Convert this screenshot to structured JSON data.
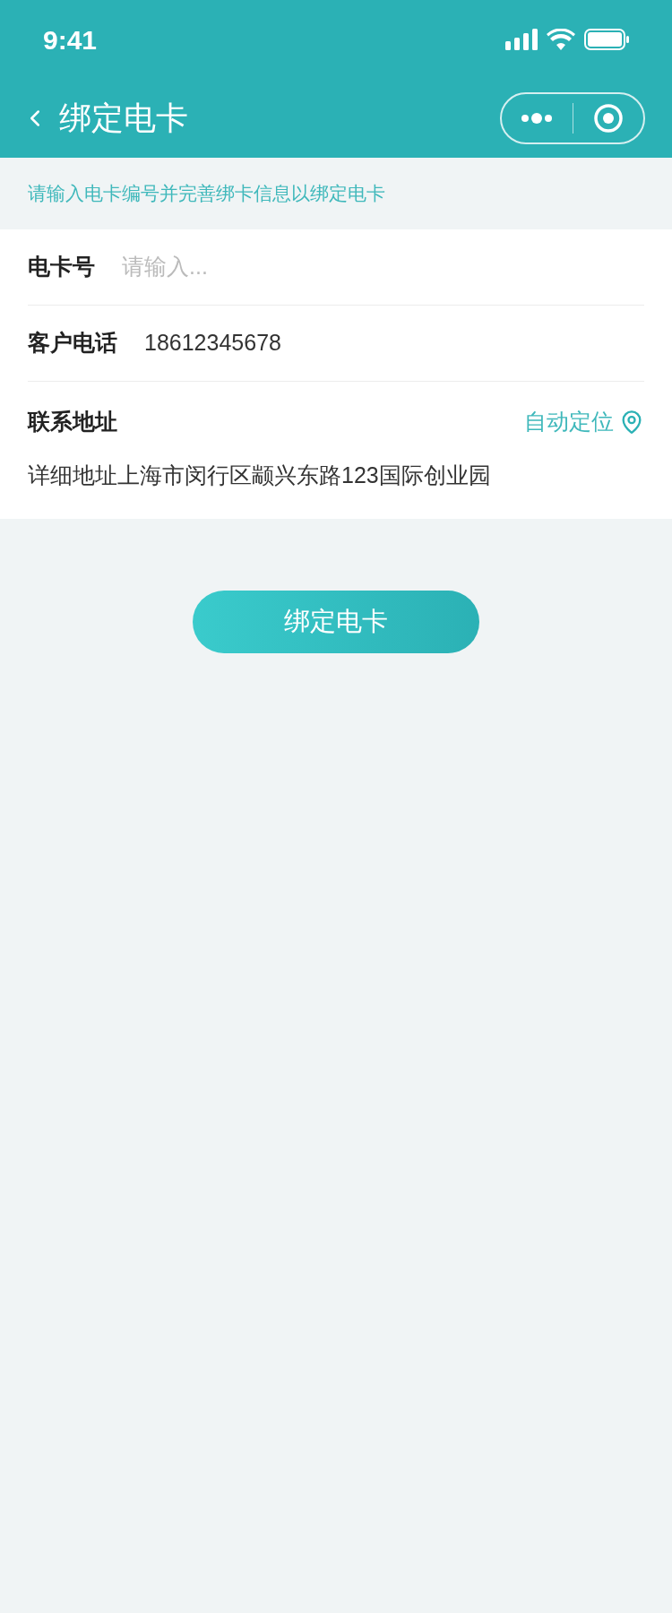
{
  "status_bar": {
    "time": "9:41"
  },
  "nav": {
    "title": "绑定电卡"
  },
  "hint": "请输入电卡编号并完善绑卡信息以绑定电卡",
  "form": {
    "card": {
      "label": "电卡号",
      "placeholder": "请输入..."
    },
    "phone": {
      "label": "客户电话",
      "value": "18612345678"
    },
    "address": {
      "label": "联系地址",
      "locate": "自动定位",
      "value": "详细地址上海市闵行区颛兴东路123国际创业园"
    }
  },
  "submit": "绑定电卡"
}
